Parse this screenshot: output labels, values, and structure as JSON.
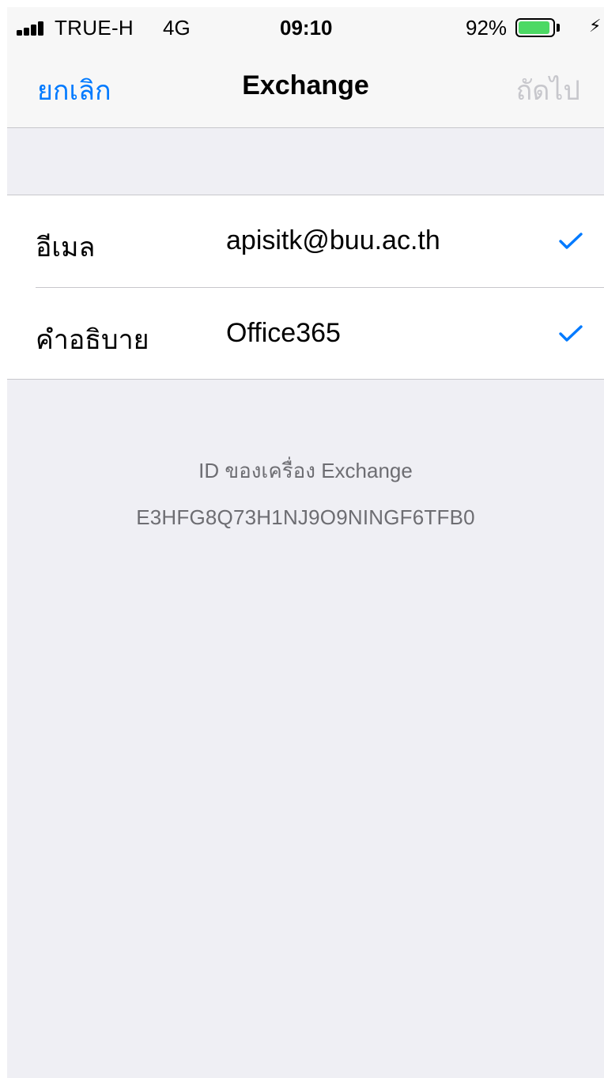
{
  "status_bar": {
    "carrier": "TRUE-H",
    "network": "4G",
    "time": "09:10",
    "battery_percent": "92%",
    "battery_level": 0.92,
    "signal_icon": "signal-bars-icon",
    "charging_icon": "lightning-bolt-icon"
  },
  "nav": {
    "cancel_label": "ยกเลิก",
    "title": "Exchange",
    "next_label": "ถัดไป"
  },
  "form": {
    "rows": [
      {
        "label": "อีเมล",
        "value": "apisitk@buu.ac.th",
        "status_icon": "checkmark-icon"
      },
      {
        "label": "คำอธิบาย",
        "value": "Office365",
        "status_icon": "checkmark-icon"
      }
    ]
  },
  "device_info": {
    "title": "ID ของเครื่อง Exchange",
    "device_id": "E3HFG8Q73H1NJ9O9NINGF6TFB0"
  },
  "colors": {
    "accent": "#007aff",
    "disabled": "#c7c7cc",
    "battery_fill": "#4cd964",
    "background": "#efeff4",
    "secondary_text": "#6d6d72"
  }
}
